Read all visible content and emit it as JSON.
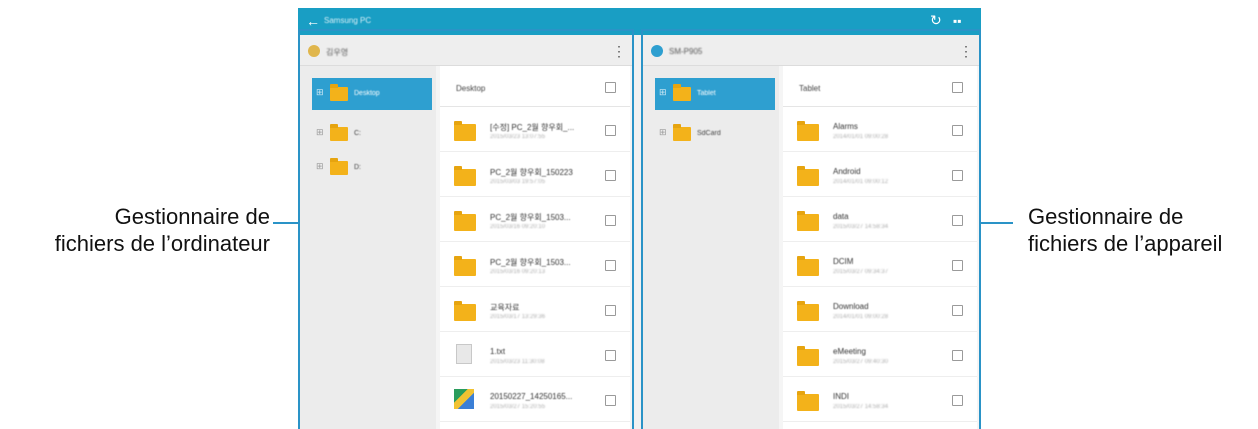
{
  "annotations": {
    "left_line1": "Gestionnaire de",
    "left_line2": "fichiers de l’ordinateur",
    "right_line1": "Gestionnaire de",
    "right_line2": "fichiers de l’appareil"
  },
  "appbar": {
    "back_glyph": "←",
    "title": "Samsung PC",
    "refresh_glyph": "↻",
    "grid_glyph": "▪▪",
    "icons": [
      "back-arrow-icon",
      "refresh-icon",
      "grid-view-icon"
    ],
    "color": "#199ec4"
  },
  "computer_pane": {
    "name": "김우영",
    "avatar_color": "#e0b64c",
    "more_glyph": "⋮",
    "tree": [
      {
        "label": "Desktop",
        "selected": true
      },
      {
        "label": "C:",
        "selected": false
      },
      {
        "label": "D:",
        "selected": false
      }
    ],
    "list_title": "Desktop",
    "rows": [
      {
        "name": "[수정] PC_2월 향우회_...",
        "date": "2015/03/23 13:07:55",
        "icon": "folder-icon"
      },
      {
        "name": "PC_2월 향우회_150223",
        "date": "2015/03/03 19:57:05",
        "icon": "folder-icon"
      },
      {
        "name": "PC_2월 향우회_1503...",
        "date": "2015/03/16 09:20:10",
        "icon": "folder-icon"
      },
      {
        "name": "PC_2월 향우회_1503...",
        "date": "2015/03/16 09:20:13",
        "icon": "folder-icon"
      },
      {
        "name": "교육자료",
        "date": "2015/03/17 13:29:36",
        "icon": "folder-icon"
      },
      {
        "name": "1.txt",
        "date": "2015/03/23 11:30:08",
        "icon": "text-file-icon"
      },
      {
        "name": "20150227_14250165...",
        "date": "2015/03/27 15:20:55",
        "icon": "image-file-icon"
      }
    ]
  },
  "device_pane": {
    "name": "SM-P905",
    "avatar_color": "#2e9fd0",
    "more_glyph": "⋮",
    "tree": [
      {
        "label": "Tablet",
        "selected": true
      },
      {
        "label": "SdCard",
        "selected": false
      }
    ],
    "list_title": "Tablet",
    "rows": [
      {
        "name": "Alarms",
        "date": "2014/01/01 09:00:28",
        "icon": "folder-icon"
      },
      {
        "name": "Android",
        "date": "2014/01/01 09:00:12",
        "icon": "folder-icon"
      },
      {
        "name": "data",
        "date": "2015/03/27 14:58:34",
        "icon": "folder-icon"
      },
      {
        "name": "DCIM",
        "date": "2015/03/27 09:34:37",
        "icon": "folder-icon"
      },
      {
        "name": "Download",
        "date": "2014/01/01 09:00:28",
        "icon": "folder-icon"
      },
      {
        "name": "eMeeting",
        "date": "2015/03/27 09:40:30",
        "icon": "folder-icon"
      },
      {
        "name": "INDI",
        "date": "2015/03/27 14:58:34",
        "icon": "folder-icon"
      }
    ]
  }
}
